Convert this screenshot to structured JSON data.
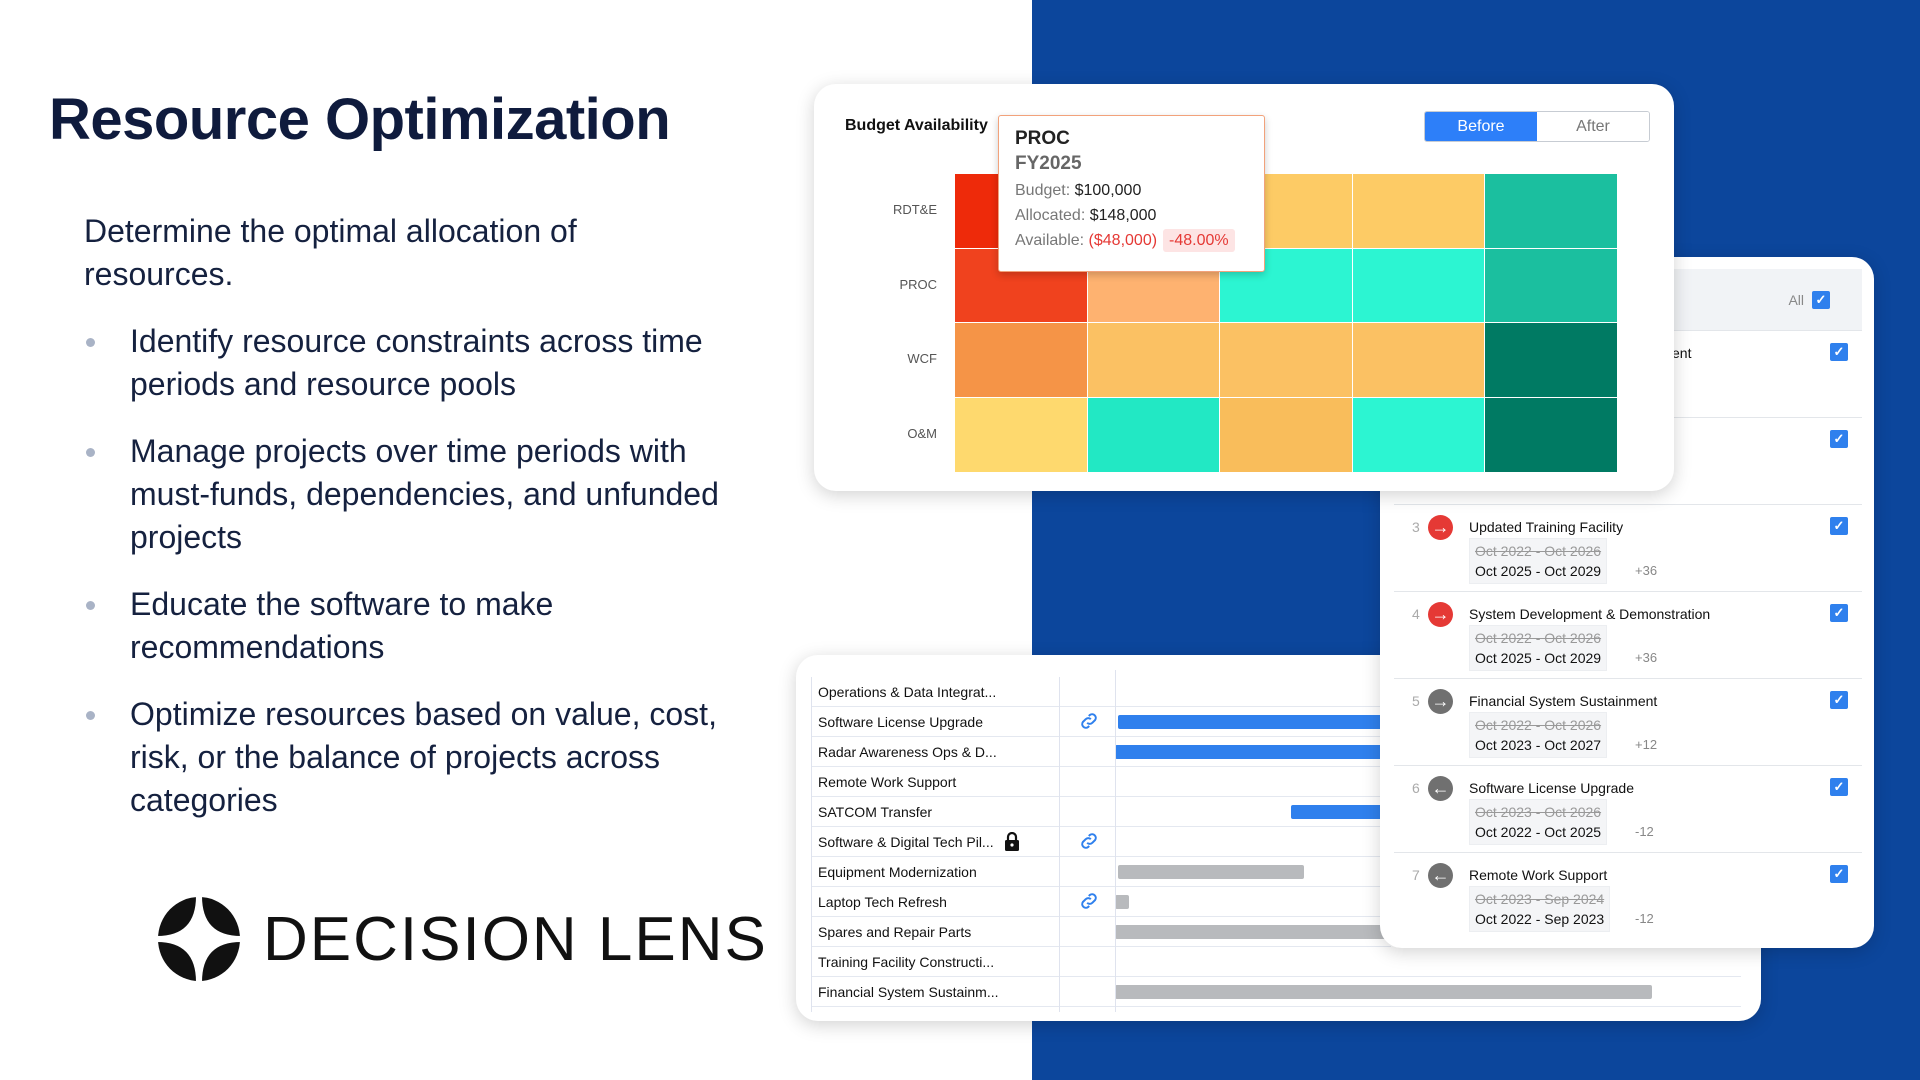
{
  "slide": {
    "title": "Resource Optimization",
    "intro": "Determine the optimal allocation of resources.",
    "bullets": [
      "Identify resource constraints across time periods and resource pools",
      "Manage projects over time periods with must-funds, dependencies, and unfunded projects",
      "Educate the software to make recommendations",
      "Optimize resources based on value, cost, risk, or the balance of projects across categories"
    ],
    "logo_text": "DECISION LENS",
    "background_accent": "#0c469c"
  },
  "heatmap": {
    "title": "Budget Availability",
    "toggle": {
      "before": "Before",
      "after": "After",
      "selected": "Before"
    },
    "rows": [
      "RDT&E",
      "PROC",
      "WCF",
      "O&M"
    ],
    "colors": [
      [
        "#ee2a0a",
        "#feb270",
        "#fdcb65",
        "#fdcb65",
        "#1bbf9f"
      ],
      [
        "#f0421e",
        "#feb270",
        "#2cf5d2",
        "#2cf5d2",
        "#1bbf9f"
      ],
      [
        "#f59447",
        "#fbc163",
        "#fbc163",
        "#fbc163",
        "#007a63"
      ],
      [
        "#fed96e",
        "#22e8c4",
        "#f9bd5b",
        "#2cf5d2",
        "#007a63"
      ]
    ],
    "tooltip": {
      "category": "PROC",
      "period": "FY2025",
      "budget_label": "Budget:",
      "budget": "$100,000",
      "allocated_label": "Allocated:",
      "allocated": "$148,000",
      "available_label": "Available:",
      "available": "($48,000)",
      "available_pct": "-48.00%"
    }
  },
  "panel": {
    "all_label": "All",
    "rows": [
      {
        "num": "",
        "title": "ent",
        "checked": true
      },
      {
        "num": "",
        "title": "",
        "checked": true
      },
      {
        "num": "3",
        "icon": "arrow-right-icon",
        "icon_color": "#e53935",
        "title": "Updated Training Facility",
        "old": "Oct 2022 - Oct 2026",
        "new": "Oct 2025 - Oct 2029",
        "delta": "+36",
        "checked": true
      },
      {
        "num": "4",
        "icon": "arrow-right-icon",
        "icon_color": "#e53935",
        "title": "System Development & Demonstration",
        "old": "Oct 2022 - Oct 2026",
        "new": "Oct 2025 - Oct 2029",
        "delta": "+36",
        "checked": true
      },
      {
        "num": "5",
        "icon": "arrow-right-icon",
        "icon_color": "#707070",
        "title": "Financial System Sustainment",
        "old": "Oct 2022 - Oct 2026",
        "new": "Oct 2023 - Oct 2027",
        "delta": "+12",
        "checked": true
      },
      {
        "num": "6",
        "icon": "arrow-left-icon",
        "icon_color": "#707070",
        "title": "Software License Upgrade",
        "old": "Oct 2023 - Oct 2026",
        "new": "Oct 2022 - Oct 2025",
        "delta": "-12",
        "checked": true
      },
      {
        "num": "7",
        "icon": "arrow-left-icon",
        "icon_color": "#707070",
        "title": "Remote Work Support",
        "old": "Oct 2023 - Sep 2024",
        "new": "Oct 2022 - Sep 2023",
        "delta": "-12",
        "checked": true
      }
    ]
  },
  "gantt": {
    "bar_colors": {
      "blue": "#2f80ed",
      "gray": "#b8babd"
    },
    "rows": [
      {
        "label": "Operations & Data Integrat...",
        "link": false,
        "lock": false,
        "bar": null
      },
      {
        "label": "Software License Upgrade",
        "link": true,
        "lock": false,
        "bar": "blue"
      },
      {
        "label": "Radar Awareness Ops & D...",
        "link": false,
        "lock": false,
        "bar": "blue"
      },
      {
        "label": "Remote Work Support",
        "link": false,
        "lock": false,
        "bar": null
      },
      {
        "label": "SATCOM Transfer",
        "link": false,
        "lock": false,
        "bar": "blue"
      },
      {
        "label": "Software & Digital Tech Pil...",
        "link": true,
        "lock": true,
        "bar": null
      },
      {
        "label": "Equipment Modernization",
        "link": false,
        "lock": false,
        "bar": "gray"
      },
      {
        "label": "Laptop Tech Refresh",
        "link": true,
        "lock": false,
        "bar": "gray"
      },
      {
        "label": "Spares and Repair Parts",
        "link": false,
        "lock": false,
        "bar": "gray"
      },
      {
        "label": "Training Facility Constructi...",
        "link": false,
        "lock": false,
        "bar": null
      },
      {
        "label": "Financial System Sustainm...",
        "link": false,
        "lock": false,
        "bar": "gray"
      }
    ]
  }
}
